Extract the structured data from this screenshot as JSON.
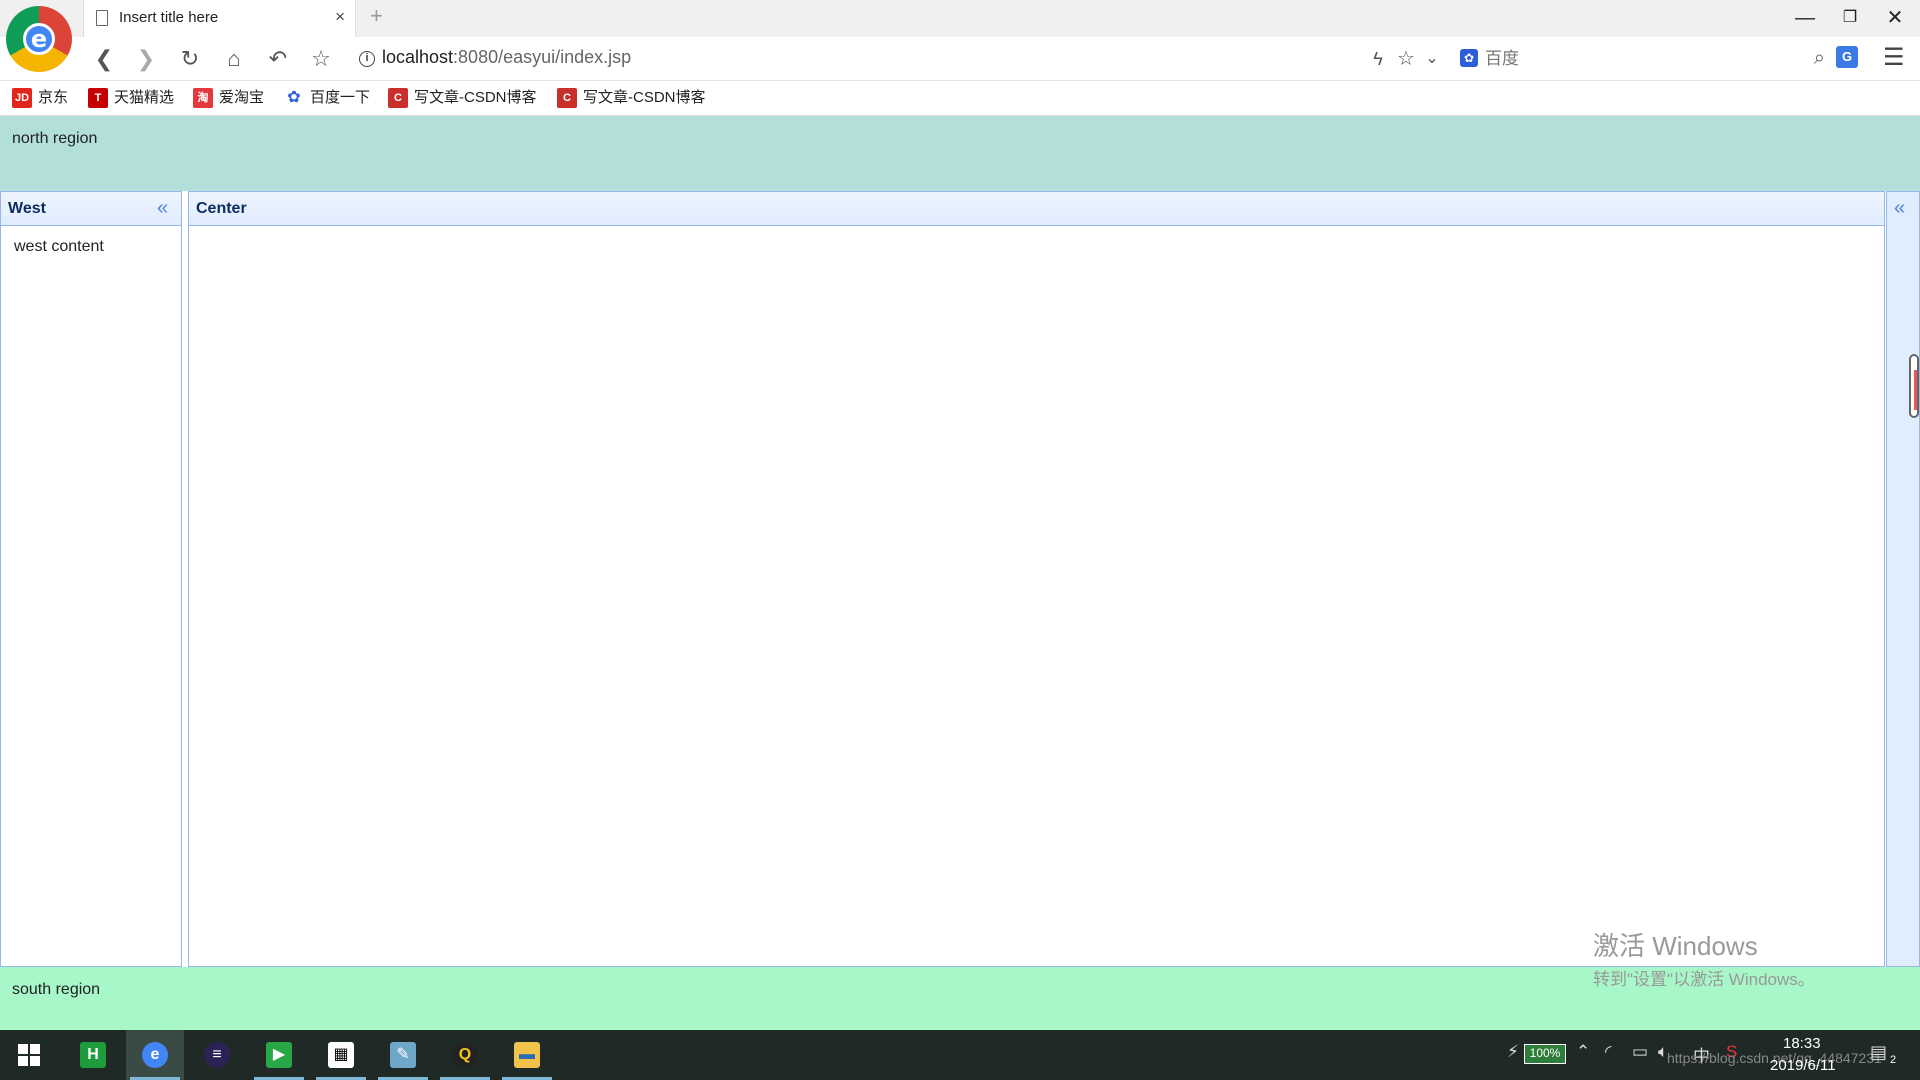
{
  "browser": {
    "tab_title": "Insert title here",
    "tab_close": "×",
    "new_tab": "+",
    "url_host": "localhost",
    "url_path": ":8080/easyui/index.jsp",
    "search_placeholder": "百度",
    "window": {
      "minimize": "—",
      "maximize": "❐",
      "close": "✕"
    }
  },
  "bookmarks": [
    {
      "label": "京东",
      "icon_text": "JD",
      "color": "#e1251b"
    },
    {
      "label": "天猫精选",
      "icon_text": "T",
      "color": "#c40000"
    },
    {
      "label": "爱淘宝",
      "icon_text": "淘",
      "color": "#e4393c"
    },
    {
      "label": "百度一下",
      "icon_text": "✿",
      "color": "#2b5ed8"
    },
    {
      "label": "写文章-CSDN博客",
      "icon_text": "C",
      "color": "#c9302c"
    },
    {
      "label": "写文章-CSDN博客",
      "icon_text": "C",
      "color": "#c9302c"
    }
  ],
  "layout": {
    "north": "north region",
    "west_title": "West",
    "west_content": "west content",
    "center_title": "Center",
    "south": "south region",
    "collapse_glyph": "«"
  },
  "watermark": {
    "line1": "激活 Windows",
    "line2": "转到\"设置\"以激活 Windows。"
  },
  "taskbar": {
    "battery": "100%",
    "time": "18:33",
    "date": "2019/6/11",
    "status_url": "https://blog.csdn.net/qq_44847231",
    "ime": "中",
    "notification_count": "2"
  },
  "colors": {
    "north_bg": "#b3dfda",
    "south_bg": "#a7f7c9",
    "panel_border": "#95b8e7",
    "panel_header": "#e0ecff"
  }
}
